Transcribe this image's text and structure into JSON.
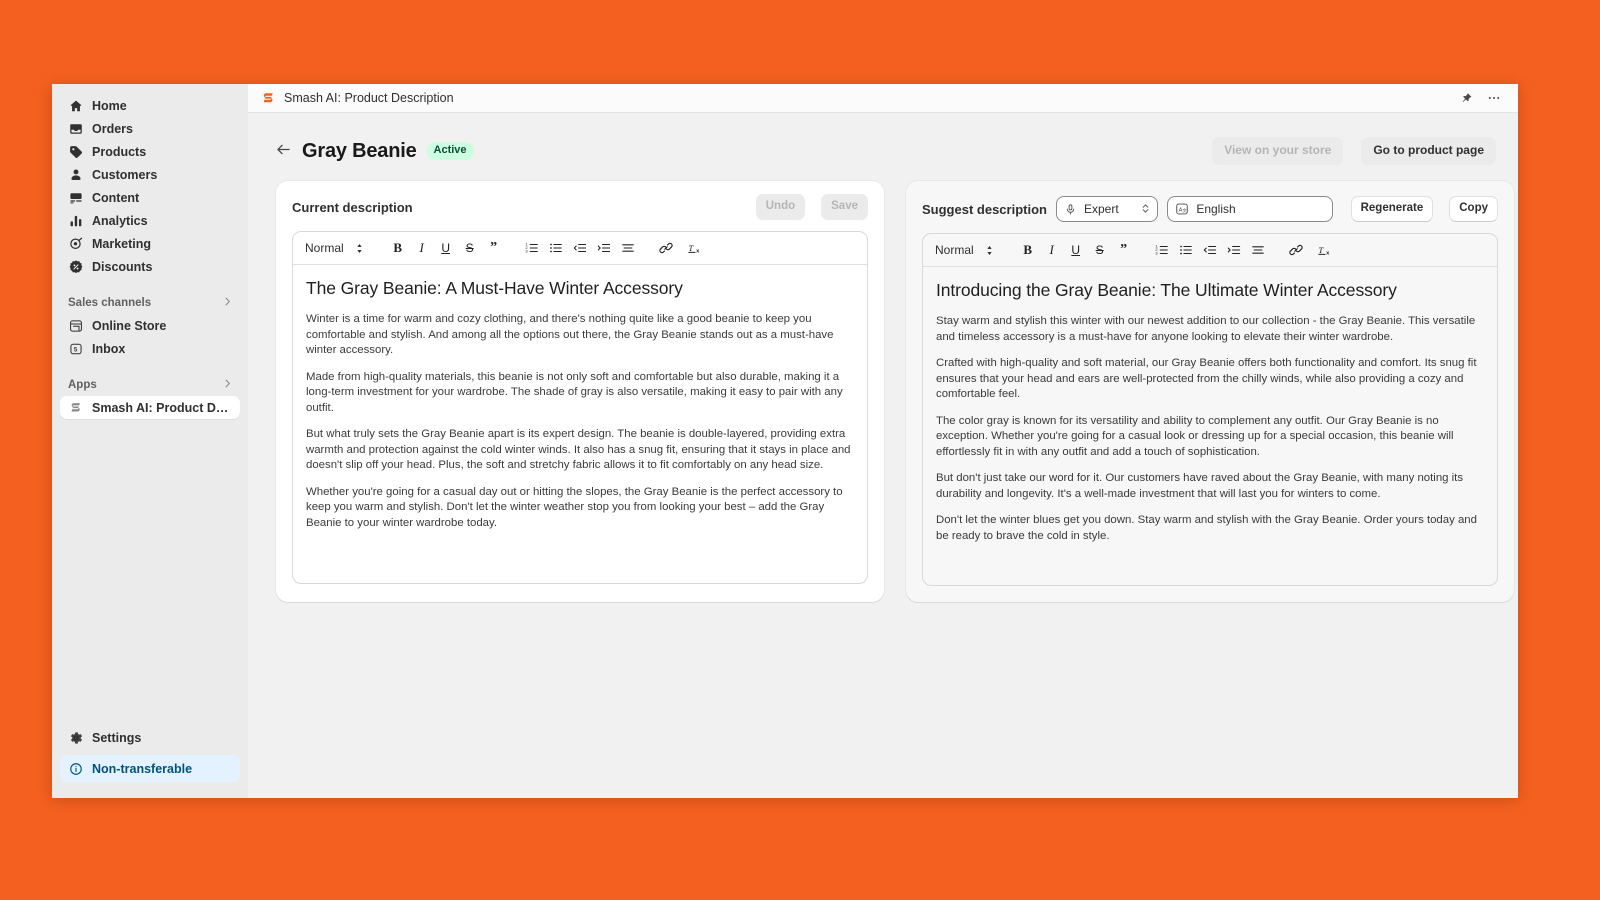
{
  "app": {
    "title": "Smash AI: Product Description",
    "logo_icon": "smash-s-logo",
    "pin_icon": "pin-icon",
    "more_icon": "ellipsis-icon"
  },
  "sidebar": {
    "items": [
      {
        "label": "Home",
        "icon": "home-icon"
      },
      {
        "label": "Orders",
        "icon": "orders-inbox-icon"
      },
      {
        "label": "Products",
        "icon": "products-tag-icon"
      },
      {
        "label": "Customers",
        "icon": "customers-person-icon"
      },
      {
        "label": "Content",
        "icon": "content-icon"
      },
      {
        "label": "Analytics",
        "icon": "analytics-bars-icon"
      },
      {
        "label": "Marketing",
        "icon": "marketing-target-icon"
      },
      {
        "label": "Discounts",
        "icon": "discounts-badge-icon"
      }
    ],
    "sections": [
      {
        "label": "Sales channels",
        "chevron_icon": "chevron-right-icon",
        "items": [
          {
            "label": "Online Store",
            "icon": "online-store-icon"
          },
          {
            "label": "Inbox",
            "icon": "inbox-icon"
          }
        ]
      },
      {
        "label": "Apps",
        "chevron_icon": "chevron-right-icon",
        "items": [
          {
            "label": "Smash AI: Product Descri...",
            "icon": "smash-s-logo",
            "active": true
          }
        ]
      }
    ],
    "settings": {
      "label": "Settings",
      "icon": "gear-icon"
    },
    "notice": {
      "label": "Non-transferable",
      "icon": "info-circle-icon"
    }
  },
  "page": {
    "back_icon": "arrow-left-icon",
    "title": "Gray Beanie",
    "status": "Active",
    "view_store_button": "View on your store",
    "product_page_button": "Go to product page"
  },
  "left_panel": {
    "heading": "Current description",
    "undo_button": "Undo",
    "save_button": "Save",
    "toolbar": {
      "block_format": "Normal",
      "stepper_icon": "stepper-updown-icon",
      "bold": "B",
      "italic": "I",
      "underline": "U",
      "strike": "S",
      "quote": "”",
      "ordered_list_icon": "ordered-list-icon",
      "bullet_list_icon": "bullet-list-icon",
      "outdent_icon": "outdent-icon",
      "indent_icon": "indent-icon",
      "align_icon": "align-icon",
      "link_icon": "link-icon",
      "clear_format_icon": "clear-format-icon"
    },
    "doc": {
      "title": "The Gray Beanie: A Must-Have Winter Accessory",
      "paragraphs": [
        "Winter is a time for warm and cozy clothing, and there's nothing quite like a good beanie to keep you comfortable and stylish. And among all the options out there, the Gray Beanie stands out as a must-have winter accessory.",
        "Made from high-quality materials, this beanie is not only soft and comfortable but also durable, making it a long-term investment for your wardrobe. The shade of gray is also versatile, making it easy to pair with any outfit.",
        "But what truly sets the Gray Beanie apart is its expert design. The beanie is double-layered, providing extra warmth and protection against the cold winter winds. It also has a snug fit, ensuring that it stays in place and doesn't slip off your head. Plus, the soft and stretchy fabric allows it to fit comfortably on any head size.",
        "Whether you're going for a casual day out or hitting the slopes, the Gray Beanie is the perfect accessory to keep you warm and stylish. Don't let the winter weather stop you from looking your best – add the Gray Beanie to your winter wardrobe today."
      ]
    }
  },
  "right_panel": {
    "heading": "Suggest description",
    "tone_select": {
      "value": "Expert",
      "icon": "microphone-icon"
    },
    "language_select": {
      "value": "English",
      "icon": "translate-icon"
    },
    "regenerate_button": "Regenerate",
    "copy_button": "Copy",
    "toolbar": {
      "block_format": "Normal",
      "stepper_icon": "stepper-updown-icon",
      "bold": "B",
      "italic": "I",
      "underline": "U",
      "strike": "S",
      "quote": "”",
      "ordered_list_icon": "ordered-list-icon",
      "bullet_list_icon": "bullet-list-icon",
      "outdent_icon": "outdent-icon",
      "indent_icon": "indent-icon",
      "align_icon": "align-icon",
      "link_icon": "link-icon",
      "clear_format_icon": "clear-format-icon"
    },
    "doc": {
      "title": "Introducing the Gray Beanie: The Ultimate Winter Accessory",
      "paragraphs": [
        "Stay warm and stylish this winter with our newest addition to our collection - the Gray Beanie. This versatile and timeless accessory is a must-have for anyone looking to elevate their winter wardrobe.",
        "Crafted with high-quality and soft material, our Gray Beanie offers both functionality and comfort. Its snug fit ensures that your head and ears are well-protected from the chilly winds, while also providing a cozy and comfortable feel.",
        "The color gray is known for its versatility and ability to complement any outfit. Our Gray Beanie is no exception. Whether you're going for a casual look or dressing up for a special occasion, this beanie will effortlessly fit in with any outfit and add a touch of sophistication.",
        "But don't just take our word for it. Our customers have raved about the Gray Beanie, with many noting its durability and longevity. It's a well-made investment that will last you for winters to come.",
        "Don't let the winter blues get you down. Stay warm and stylish with the Gray Beanie. Order yours today and be ready to brave the cold in style."
      ]
    }
  },
  "colors": {
    "background": "#f4601f",
    "brand": "#f4601f",
    "badge_bg": "#cdfee1",
    "badge_text": "#0c5132",
    "notice_bg": "#e4f1ff",
    "notice_text": "#00527c"
  }
}
